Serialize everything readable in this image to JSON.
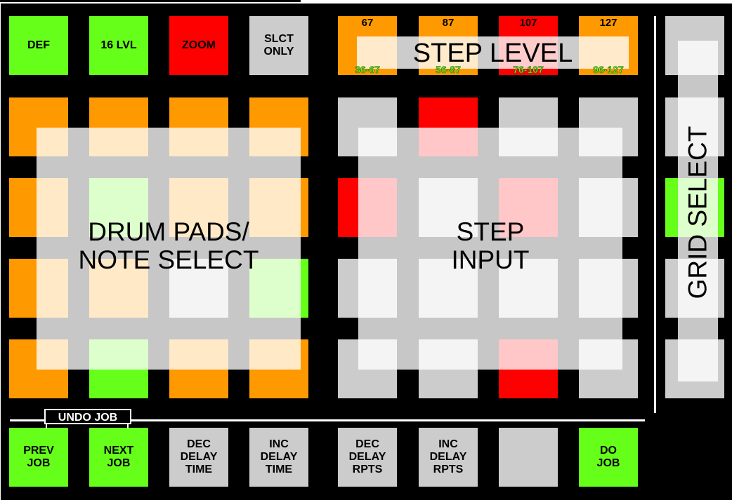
{
  "controls": {
    "def": "DEF",
    "lvl16": "16 LVL",
    "zoom": "ZOOM",
    "slct_only": "SLCT\nONLY"
  },
  "step_level": {
    "title": "STEP LEVEL",
    "levels": [
      {
        "value": "67",
        "range": "36-67"
      },
      {
        "value": "87",
        "range": "56-87"
      },
      {
        "value": "107",
        "range": "76-107"
      },
      {
        "value": "127",
        "range": "96-127"
      }
    ]
  },
  "regions": {
    "drum_pads": "DRUM PADS/\nNOTE SELECT",
    "step_input": "STEP\nINPUT",
    "grid_select": "GRID SELECT"
  },
  "undo": {
    "label": "UNDO JOB"
  },
  "bottom_row": {
    "prev_job": "PREV\nJOB",
    "next_job": "NEXT\nJOB",
    "dec_delay_time": "DEC\nDELAY\nTIME",
    "inc_delay_time": "INC\nDELAY\nTIME",
    "dec_delay_rpts": "DEC\nDELAY\nRPTS",
    "inc_delay_rpts": "INC\nDELAY\nRPTS",
    "blank": "",
    "do_job": "DO\nJOB"
  },
  "colors": {
    "orange": "#ff9900",
    "green": "#66ff1a",
    "red": "#ff0000",
    "gray": "#cccccc",
    "background": "#000000"
  }
}
